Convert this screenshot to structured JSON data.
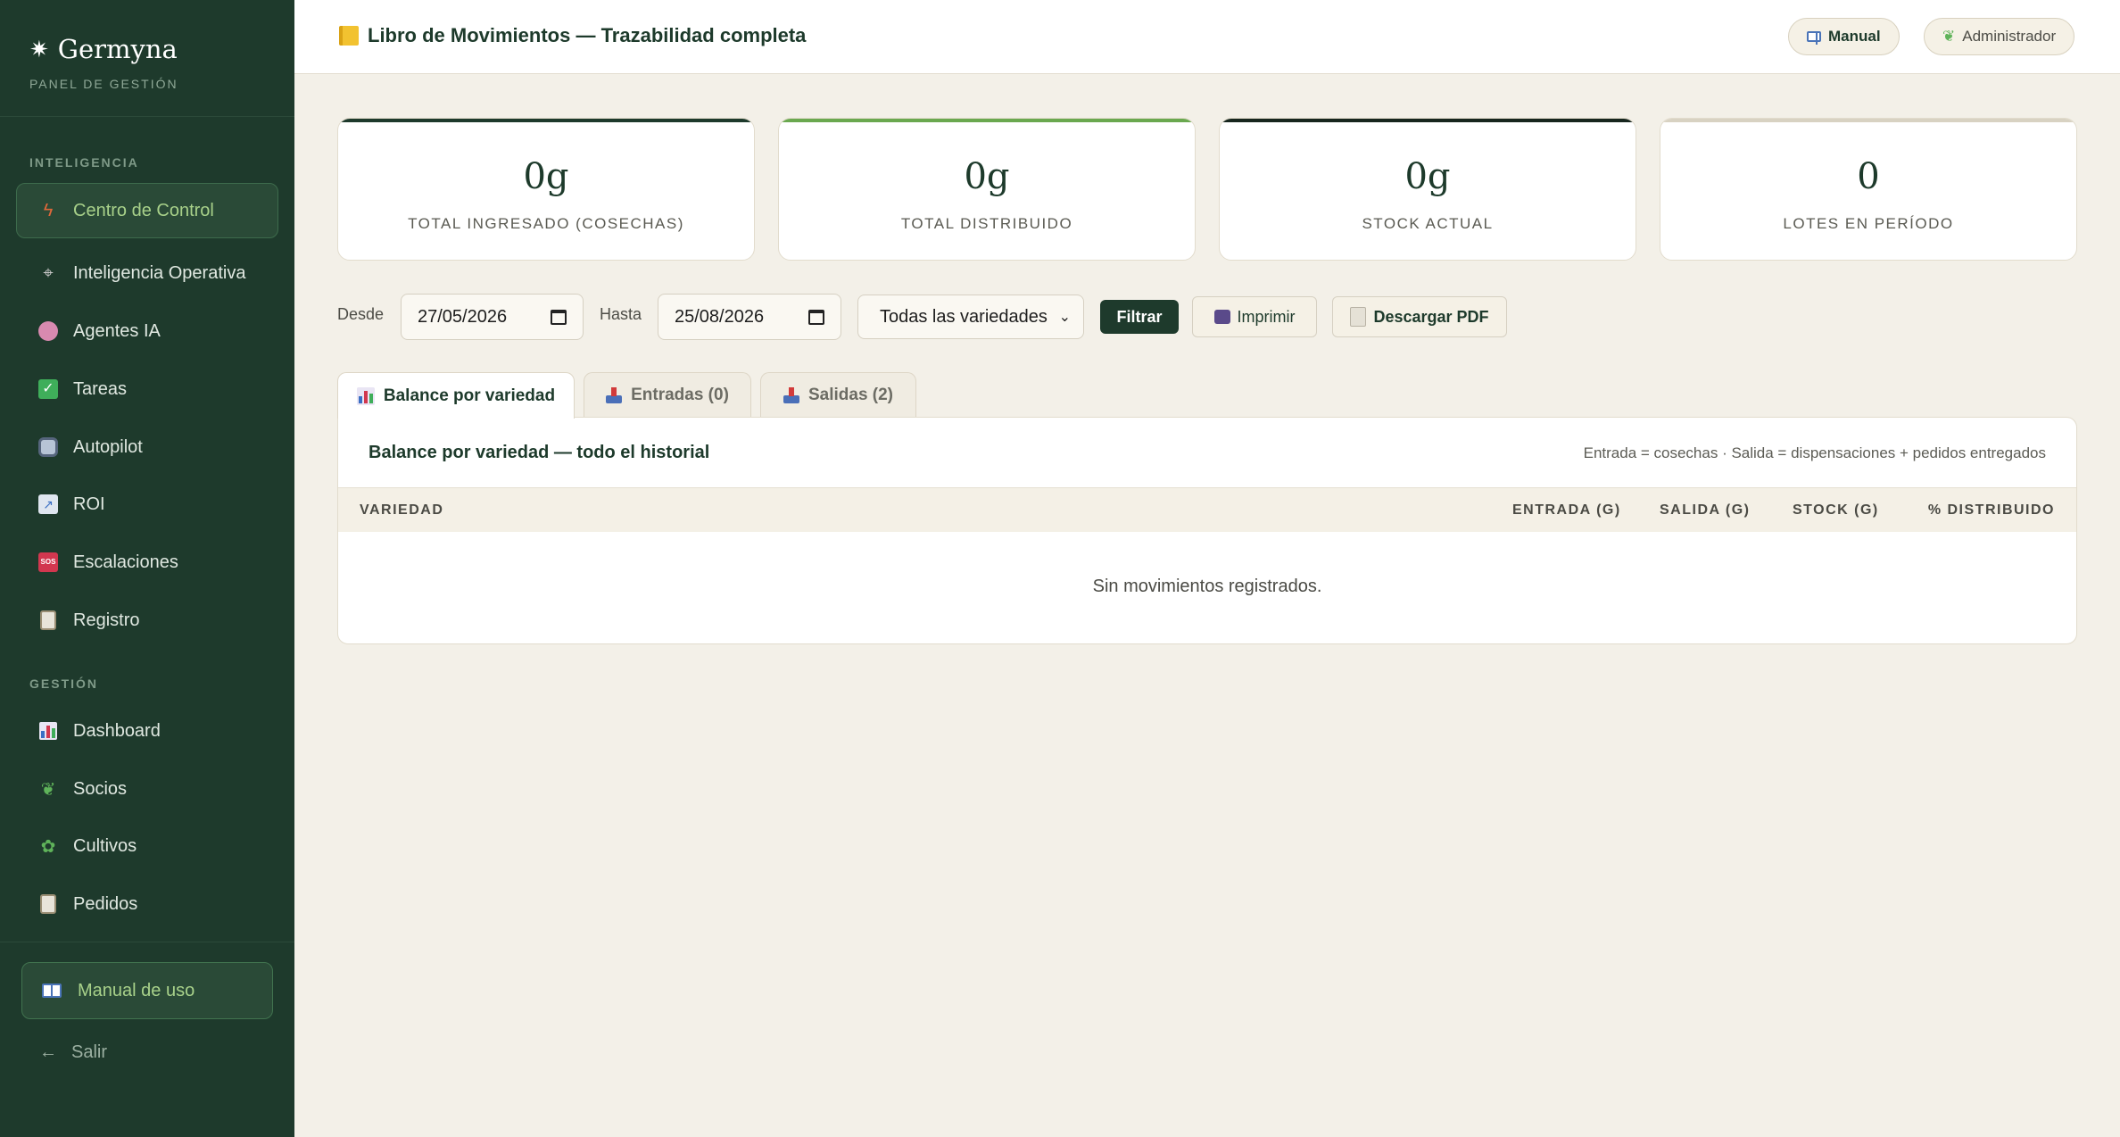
{
  "brand": {
    "name": "Germyna",
    "subtitle": "PANEL DE GESTIÓN",
    "logo_icon": "leaf-icon"
  },
  "sidebar": {
    "section_intel": "INTELIGENCIA",
    "intel_items": [
      {
        "label": "Centro de Control",
        "icon": "lightning-icon",
        "active": true
      },
      {
        "label": "Inteligencia Operativa",
        "icon": "satellite-icon"
      },
      {
        "label": "Agentes IA",
        "icon": "brain-icon"
      },
      {
        "label": "Tareas",
        "icon": "check-icon"
      },
      {
        "label": "Autopilot",
        "icon": "robot-icon"
      },
      {
        "label": "ROI",
        "icon": "trend-chart-icon"
      },
      {
        "label": "Escalaciones",
        "icon": "sos-icon"
      },
      {
        "label": "Registro",
        "icon": "clipboard-icon"
      }
    ],
    "section_gestion": "GESTIÓN",
    "gestion_items": [
      {
        "label": "Dashboard",
        "icon": "bar-chart-icon"
      },
      {
        "label": "Socios",
        "icon": "herb-icon"
      },
      {
        "label": "Cultivos",
        "icon": "potted-plant-icon"
      },
      {
        "label": "Pedidos",
        "icon": "receipt-icon"
      }
    ],
    "manual_label": "Manual de uso",
    "logout_label": "Salir",
    "logout_arrow": "←"
  },
  "header": {
    "title": "Libro de Movimientos — Trazabilidad completa",
    "manual_button": "Manual",
    "user_button": "Administrador"
  },
  "stats": [
    {
      "value": "0g",
      "label": "TOTAL INGRESADO (COSECHAS)",
      "accent": "#1e3a2c"
    },
    {
      "value": "0g",
      "label": "TOTAL DISTRIBUIDO",
      "accent": "#6aa84f"
    },
    {
      "value": "0g",
      "label": "STOCK ACTUAL",
      "accent": "#17261e"
    },
    {
      "value": "0",
      "label": "LOTES EN PERÍODO",
      "accent": "#d8d2c2"
    }
  ],
  "filters": {
    "from_label": "Desde",
    "from_value": "27/05/2026",
    "to_label": "Hasta",
    "to_value": "25/08/2026",
    "variety_selected": "Todas las variedades",
    "filter_button": "Filtrar",
    "print_button": "Imprimir",
    "pdf_button": "Descargar PDF"
  },
  "tabs": [
    {
      "label": "Balance por variedad",
      "active": true
    },
    {
      "label": "Entradas (0)"
    },
    {
      "label": "Salidas (2)"
    }
  ],
  "panel": {
    "title": "Balance por variedad — todo el historial",
    "note": "Entrada = cosechas · Salida = dispensaciones + pedidos entregados",
    "columns": [
      "VARIEDAD",
      "ENTRADA (G)",
      "SALIDA (G)",
      "STOCK (G)",
      "% DISTRIBUIDO"
    ],
    "empty_message": "Sin movimientos registrados."
  },
  "colors": {
    "sidebar_bg": "#1e3a2c",
    "accent_green": "#a8d18a",
    "page_bg": "#f3f0e8"
  }
}
